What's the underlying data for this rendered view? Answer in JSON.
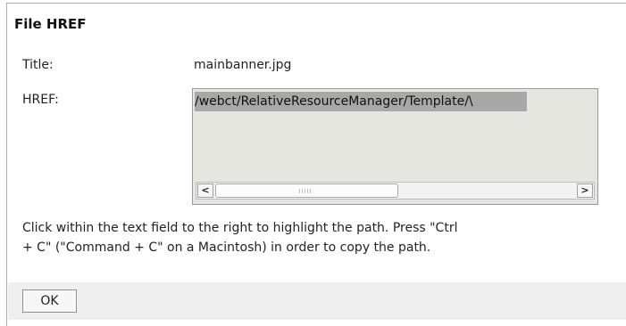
{
  "dialog": {
    "title": "File HREF",
    "fields": {
      "title_label": "Title:",
      "title_value": "mainbanner.jpg",
      "href_label": "HREF:",
      "href_value": "/webct/RelativeResourceManager/Template/\\"
    },
    "scrollbar": {
      "left_arrow": "<",
      "right_arrow": ">"
    },
    "instructions": {
      "line1": "Click within the text field to the right to highlight the path. Press \"Ctrl",
      "line2": "+ C\" (\"Command + C\" on a Macintosh) in order to copy the path."
    },
    "ok_label": "OK"
  }
}
